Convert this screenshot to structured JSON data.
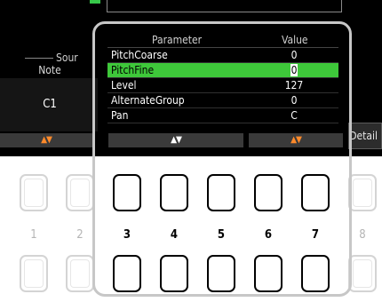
{
  "screen": {
    "source_label": "Sour",
    "note_header": "Note",
    "note_value": "C1",
    "detail_label": "Detail",
    "arrows": "▲▼"
  },
  "param_table": {
    "headers": {
      "parameter": "Parameter",
      "value": "Value"
    },
    "rows": [
      {
        "name": "PitchCoarse",
        "value": "0",
        "selected": false
      },
      {
        "name": "PitchFine",
        "value": "0",
        "selected": true
      },
      {
        "name": "Level",
        "value": "127",
        "selected": false
      },
      {
        "name": "AlternateGroup",
        "value": "0",
        "selected": false
      },
      {
        "name": "Pan",
        "value": "C",
        "selected": false
      }
    ]
  },
  "buttons": {
    "numbers": [
      "1",
      "2",
      "3",
      "4",
      "5",
      "6",
      "7",
      "8"
    ],
    "highlighted": [
      "3",
      "4",
      "5",
      "6",
      "7"
    ]
  },
  "colors": {
    "selection": "#3ec83a",
    "arrow_accent": "#ff8a2a"
  }
}
